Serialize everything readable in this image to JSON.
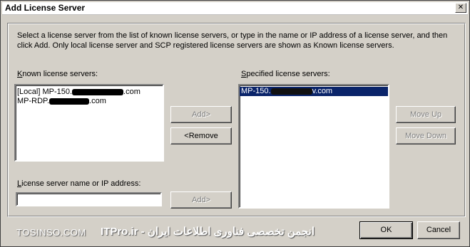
{
  "window": {
    "title": "Add License Server",
    "close_glyph": "✕"
  },
  "description": "Select a license server from the list of known license servers, or type in the name or IP address of a license server, and then click Add. Only local license server and SCP registered license servers are shown as Known license servers.",
  "known": {
    "label_key": "K",
    "label_rest": "nown license servers:",
    "items": [
      {
        "prefix": "[Local] MP-150.",
        "suffix": ".com"
      },
      {
        "prefix": "MP-RDP.",
        "suffix": ".com"
      }
    ]
  },
  "specified": {
    "label_key": "S",
    "label_rest": "pecified license servers:",
    "items": [
      {
        "prefix": "MP-150.",
        "suffix": "v.com",
        "selected": true
      }
    ]
  },
  "buttons": {
    "add_top": "Add>",
    "remove": "<Remove",
    "add_bottom": "Add>",
    "move_up": "Move Up",
    "move_down": "Move Down",
    "ok": "OK",
    "cancel": "Cancel"
  },
  "input": {
    "label_key": "L",
    "label_rest": "icense server name or IP address:",
    "value": ""
  },
  "watermark": {
    "left": "TOSINSO.COM",
    "right": "ITPro.ir - انجمن تخصصی فناوری اطلاعات ایران"
  }
}
